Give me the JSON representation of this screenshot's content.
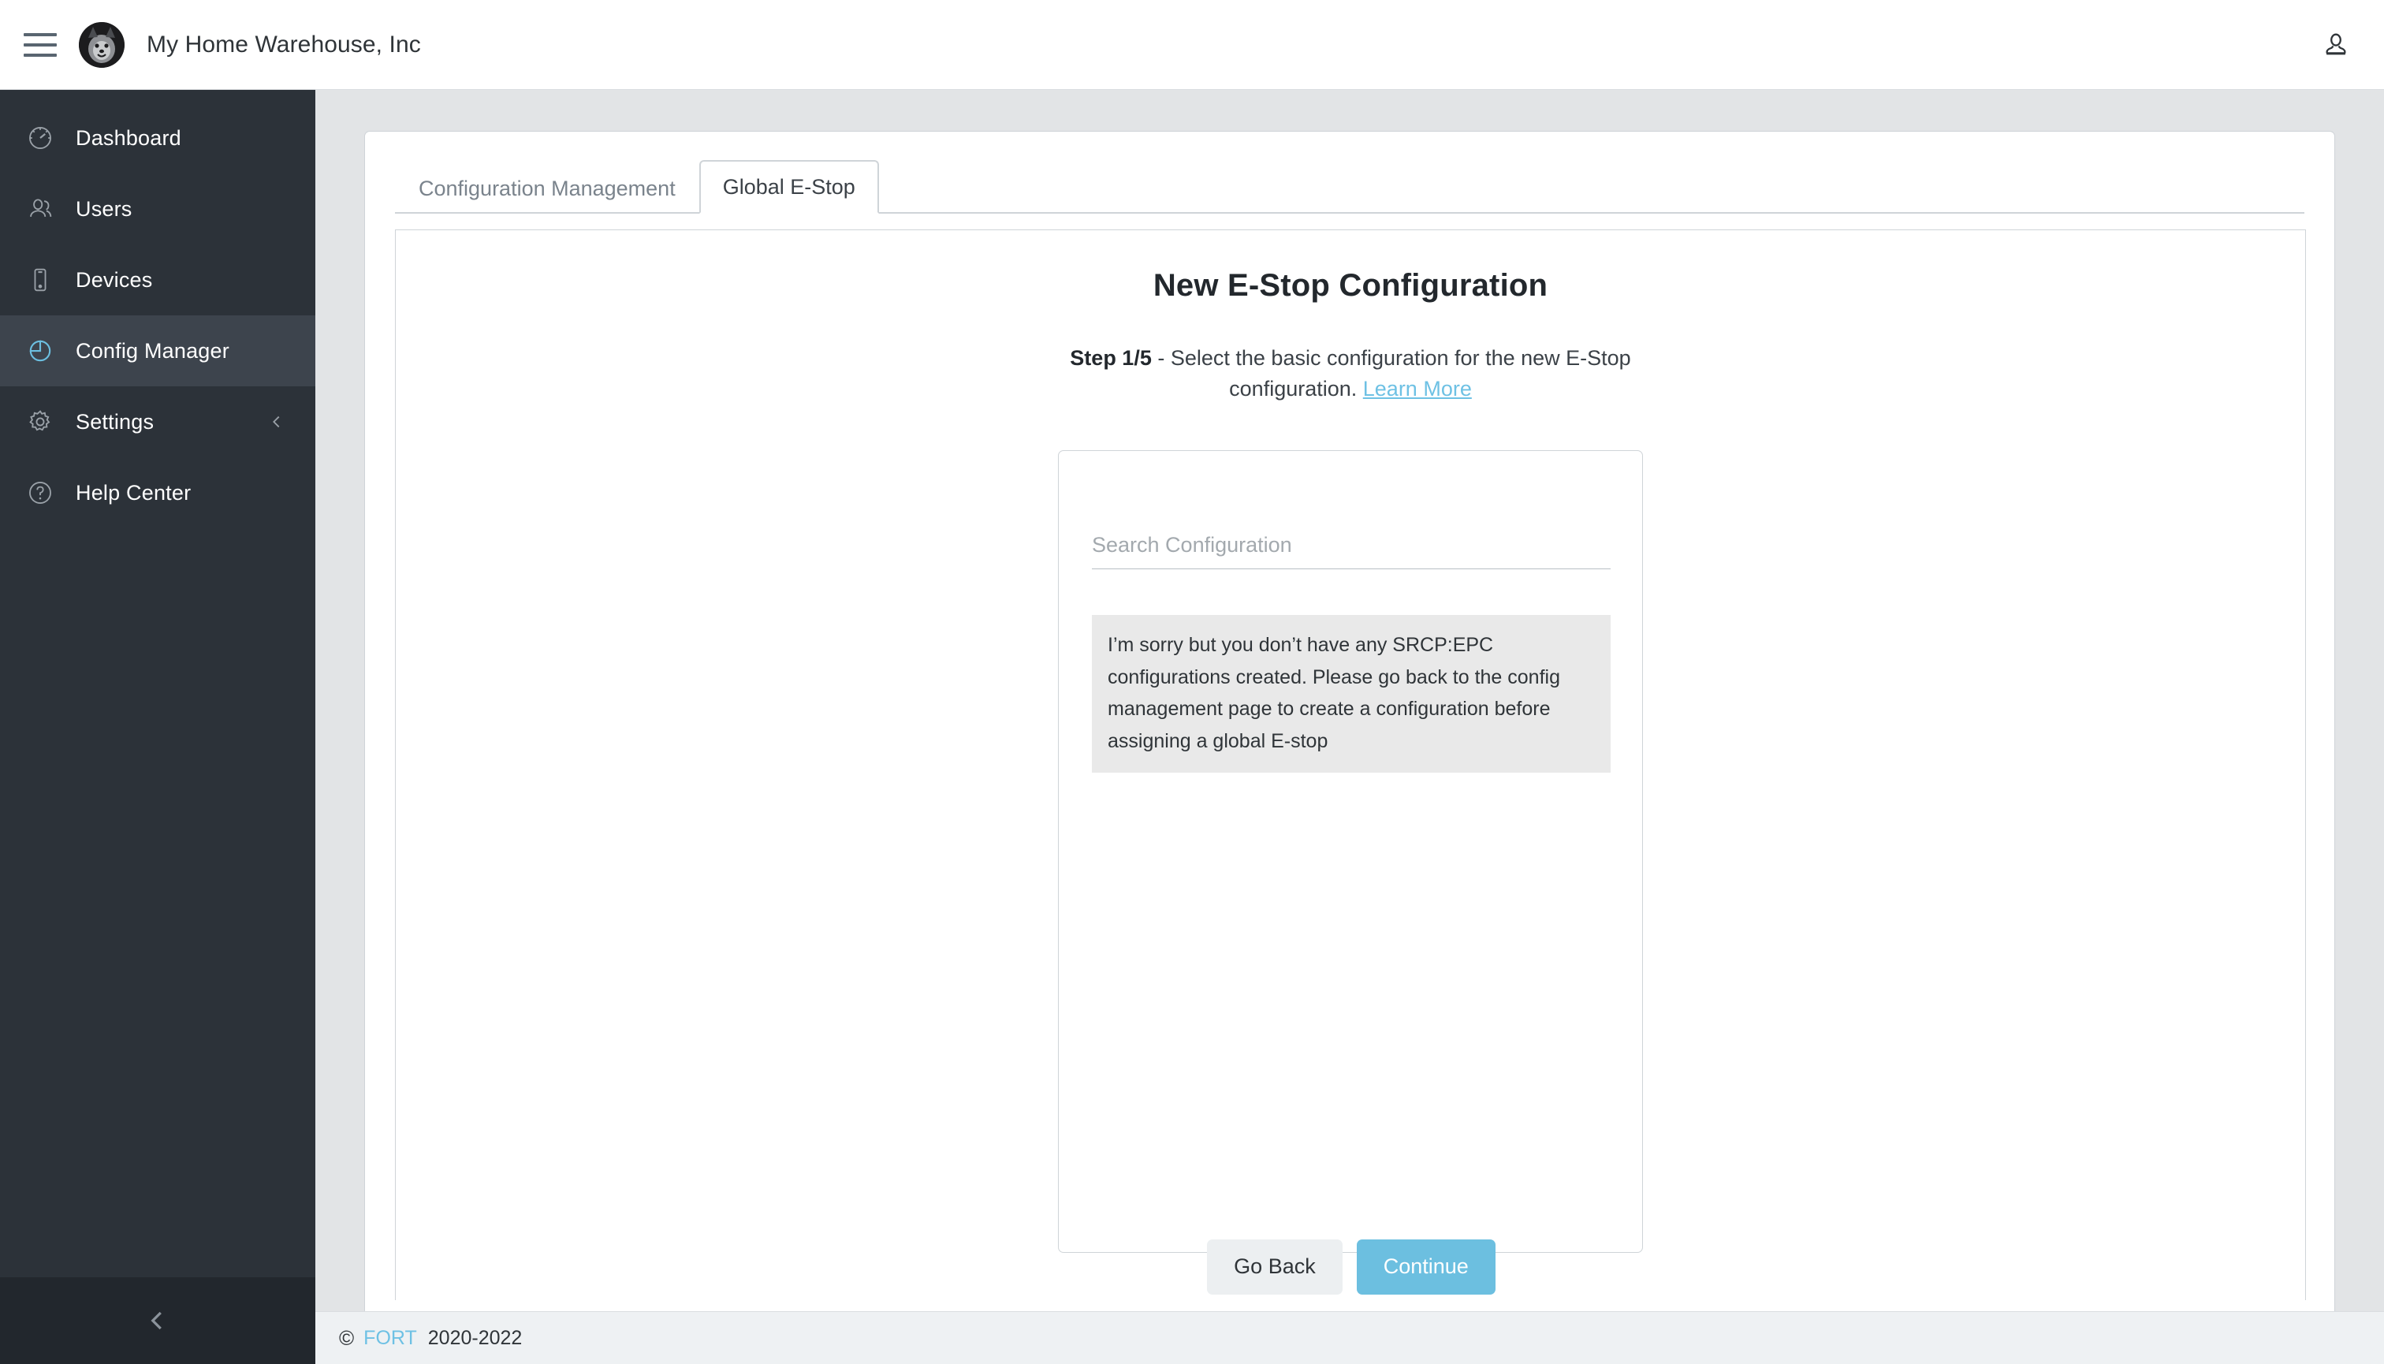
{
  "header": {
    "menu_icon": "hamburger-menu-icon",
    "avatar_icon": "company-avatar-dog",
    "title": "My Home Warehouse, Inc",
    "user_icon": "user-account-icon"
  },
  "sidebar": {
    "items": [
      {
        "label": "Dashboard",
        "icon": "gauge-icon",
        "active": false,
        "chevron": false
      },
      {
        "label": "Users",
        "icon": "users-icon",
        "active": false,
        "chevron": false
      },
      {
        "label": "Devices",
        "icon": "device-icon",
        "active": false,
        "chevron": false
      },
      {
        "label": "Config Manager",
        "icon": "pie-chart-icon",
        "active": true,
        "chevron": false
      },
      {
        "label": "Settings",
        "icon": "gear-icon",
        "active": false,
        "chevron": true
      },
      {
        "label": "Help Center",
        "icon": "question-mark-icon",
        "active": false,
        "chevron": false
      }
    ],
    "collapse_icon": "chevron-left-icon",
    "active_accent": "#6cbfe0"
  },
  "main": {
    "tabs": [
      {
        "label": "Configuration Management",
        "active": false
      },
      {
        "label": "Global E-Stop",
        "active": true
      }
    ],
    "wizard": {
      "title": "New E-Stop Configuration",
      "step_label": "Step 1/5",
      "step_separator": " - ",
      "step_text": "Select the basic configuration for the new E-Stop configuration. ",
      "learn_more": "Learn More"
    },
    "search": {
      "placeholder": "Search Configuration",
      "value": ""
    },
    "empty_message": "I’m sorry but you don’t have any SRCP:EPC configurations created. Please go back to the config management page to create a configuration before assigning a global E-stop",
    "buttons": {
      "back": "Go Back",
      "continue": "Continue"
    }
  },
  "footer": {
    "copyright_symbol": "©",
    "brand": "FORT",
    "years": "2020-2022"
  }
}
